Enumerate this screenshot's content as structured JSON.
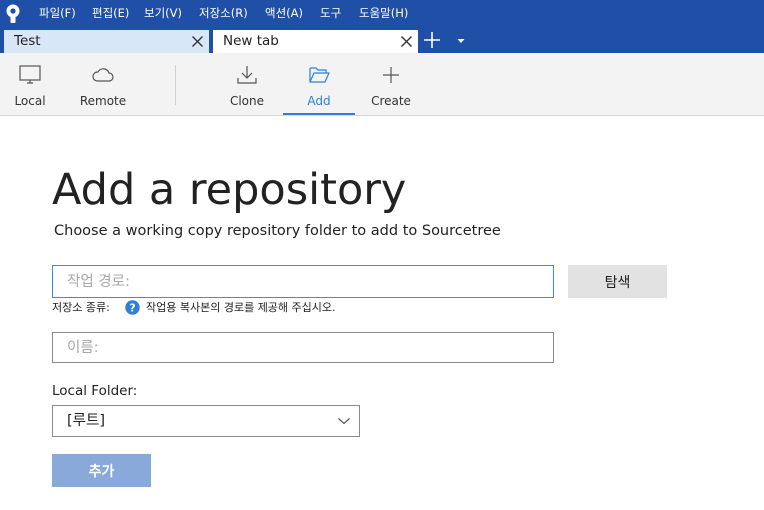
{
  "menu": {
    "items": [
      "파일(F)",
      "편집(E)",
      "보기(V)",
      "저장소(R)",
      "액션(A)",
      "도구",
      "도움말(H)"
    ]
  },
  "tabs": [
    {
      "label": "Test",
      "active": false
    },
    {
      "label": "New tab",
      "active": true
    }
  ],
  "toolbar": {
    "local": "Local",
    "remote": "Remote",
    "clone": "Clone",
    "add": "Add",
    "create": "Create",
    "active": "Add"
  },
  "content": {
    "title": "Add a repository",
    "subtitle": "Choose a working copy repository folder to add to Sourcetree",
    "path_placeholder": "작업 경로:",
    "path_value": "",
    "browse_label": "탐색",
    "repo_type_label": "저장소 종류:",
    "repo_type_hint": "작업용 복사본의 경로를 제공해 주십시오.",
    "name_placeholder": "이름:",
    "name_value": "",
    "local_folder_label": "Local Folder:",
    "local_folder_value": "[루트]",
    "add_button_label": "추가"
  },
  "colors": {
    "menubar": "#1f4fa6",
    "accent": "#2f7fd6",
    "add_button": "#88a9d9",
    "help_icon": "#2f7fd6"
  },
  "icons": {
    "app": "sourcetree-logo-icon",
    "local": "monitor-icon",
    "remote": "cloud-icon",
    "clone": "download-icon",
    "add": "folder-open-icon",
    "create": "plus-icon",
    "help": "question-circle-icon"
  }
}
